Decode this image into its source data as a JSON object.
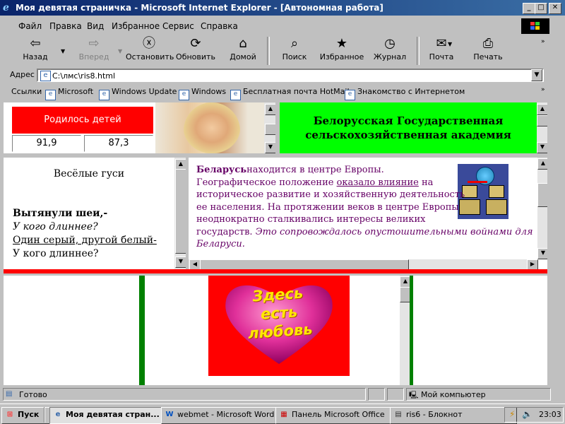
{
  "window": {
    "title": "Моя девятая страничка - Microsoft Internet Explorer - [Автономная работа]"
  },
  "menu": [
    "Файл",
    "Правка",
    "Вид",
    "Избранное",
    "Сервис",
    "Справка"
  ],
  "toolbar": {
    "back": "Назад",
    "forward": "Вперед",
    "stop": "Остановить",
    "refresh": "Обновить",
    "home": "Домой",
    "search": "Поиск",
    "favorites": "Избранное",
    "history": "Журнал",
    "mail": "Почта",
    "print": "Печать"
  },
  "address": {
    "label": "Адрес",
    "value": "C:\\лмс\\ris8.html"
  },
  "links": {
    "label": "Ссылки",
    "items": [
      "Microsoft",
      "Windows Update",
      "Windows",
      "Бесплатная почта HotMail",
      "Знакомство с Интернетом"
    ]
  },
  "frames": {
    "births": {
      "header": "Родилось детей",
      "values": [
        "91,9",
        "87,3"
      ]
    },
    "academy": {
      "line1": "Белорусская Государственная",
      "line2": "сельскохозяйственная академия"
    },
    "poem": {
      "title": "Весёлые гуси",
      "line1": "Вытянули шеи,-",
      "line2": "У кого длиннее?",
      "line3": "Один серый, другой белый-",
      "line4": "У кого длиннее?"
    },
    "belarus": {
      "bold": "Беларусь",
      "t1": "находится в центре Европы.",
      "t2": "Географическое положение",
      "link": "оказало влияние",
      "t3": "на",
      "t4": "историческое развитие и хозяйственную деятельность",
      "t5": "ее населения. На протяжении веков в центре Европы",
      "t6": "неоднократно сталкивались интересы великих",
      "t7": "государств.",
      "italic1": "Это сопровождалось опустошительными войнами для",
      "italic2": "Беларуси."
    },
    "love": {
      "l1": "Здесь",
      "l2": "есть",
      "l3": "любовь"
    }
  },
  "status": {
    "left": "Готово",
    "zone": "Мой компьютер"
  },
  "taskbar": {
    "start": "Пуск",
    "tasks": [
      "Моя девятая стран...",
      "webmet - Microsoft Word",
      "Панель Microsoft Office",
      "ris6 - Блокнот"
    ],
    "clock": "23:03"
  },
  "colors": {
    "title_start": "#0a246a",
    "frame_red": "#ff0000",
    "frame_green": "#00ff00",
    "text_purple": "#660066"
  }
}
